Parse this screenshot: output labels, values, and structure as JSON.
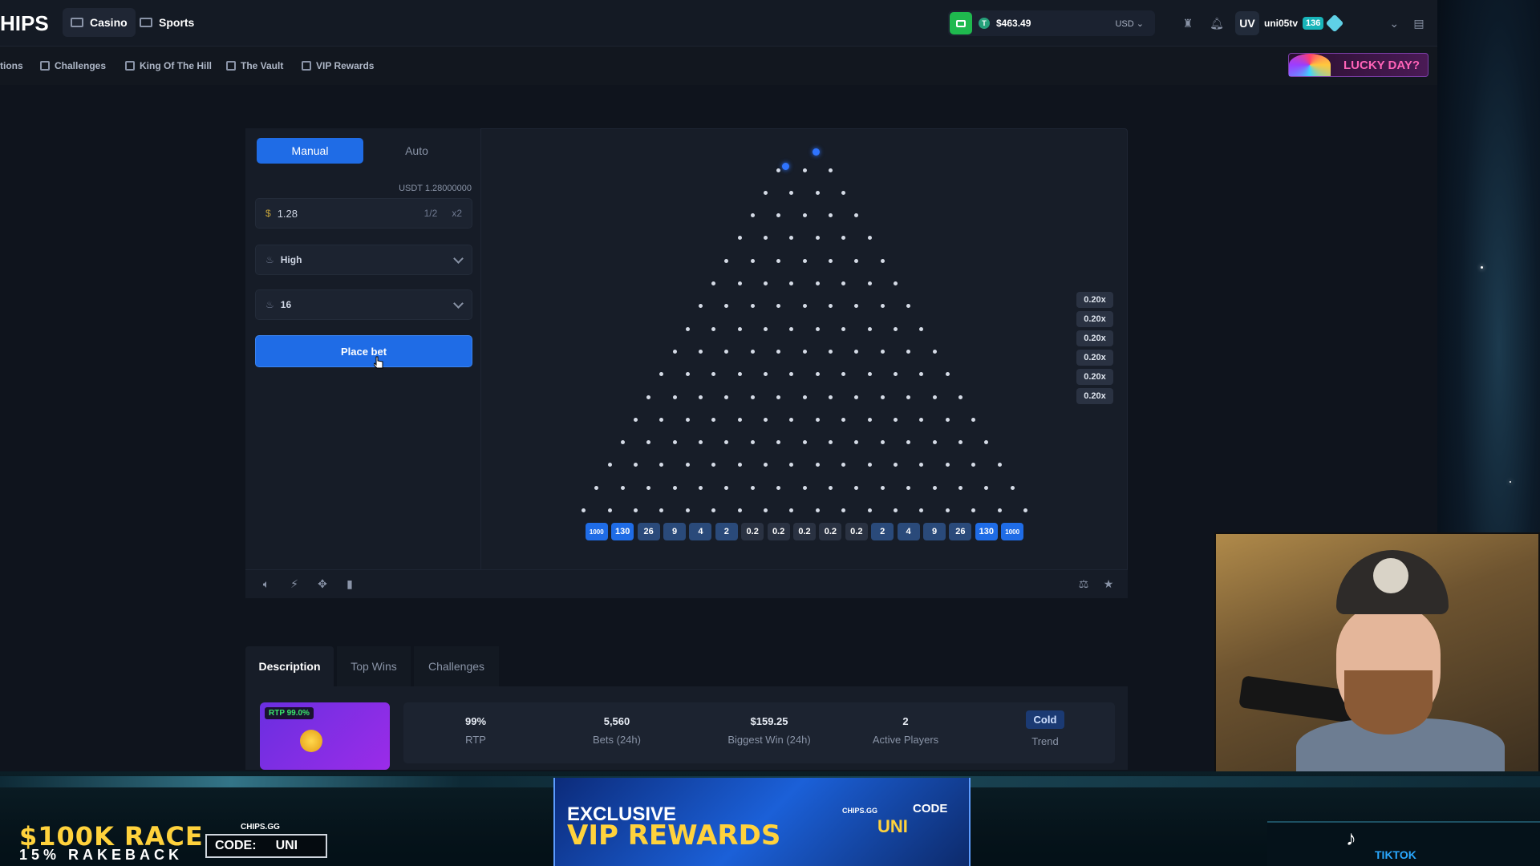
{
  "topbar": {
    "logo": "HIPS",
    "nav": [
      {
        "label": "Casino"
      },
      {
        "label": "Sports"
      }
    ],
    "wallet": {
      "coin_letter": "T",
      "balance": "$463.49",
      "currency": "USD"
    },
    "user": {
      "avatar": "UV",
      "name": "uni05tv",
      "level": "136"
    }
  },
  "subnav": {
    "items": [
      {
        "label": "tions"
      },
      {
        "label": "Challenges"
      },
      {
        "label": "King Of The Hill"
      },
      {
        "label": "The Vault"
      },
      {
        "label": "VIP Rewards"
      }
    ],
    "promo": "LUCKY DAY?"
  },
  "bet_panel": {
    "modes": [
      "Manual",
      "Auto"
    ],
    "balance_label": "USDT 1.28000000",
    "bet_currency": "$",
    "bet_amount": "1.28",
    "half_label": "1/2",
    "double_label": "x2",
    "risk": "High",
    "rows": "16",
    "place_bet": "Place bet"
  },
  "board": {
    "rows": 16,
    "multipliers": [
      "1000",
      "130",
      "26",
      "9",
      "4",
      "2",
      "0.2",
      "0.2",
      "0.2",
      "0.2",
      "0.2",
      "2",
      "4",
      "9",
      "26",
      "130",
      "1000"
    ],
    "recent_results": [
      "0.20x",
      "0.20x",
      "0.20x",
      "0.20x",
      "0.20x",
      "0.20x"
    ],
    "colors": {
      "edge": "#1f6ce6",
      "mid": "#2a4a7a",
      "center": "#2a3242"
    }
  },
  "tabs": [
    "Description",
    "Top Wins",
    "Challenges"
  ],
  "thumbnail": {
    "rtp_badge": "RTP 99.0%"
  },
  "stats": [
    {
      "value": "99%",
      "label": "RTP"
    },
    {
      "value": "5,560",
      "label": "Bets (24h)"
    },
    {
      "value": "$159.25",
      "label": "Biggest Win (24h)"
    },
    {
      "value": "2",
      "label": "Active Players"
    },
    {
      "value": "Cold",
      "label": "Trend"
    }
  ],
  "overlay": {
    "race": "$100K RACE",
    "rakeback": "15% RAKEBACK",
    "chips_small": "CHIPS.GG",
    "code_label": "CODE:",
    "code_value": "UNI",
    "vip_line1": "EXCLUSIVE",
    "vip_line2": "VIP REWARDS",
    "vip_chips": "CHIPS.GG",
    "vip_code": "CODE",
    "vip_uni": "UNI",
    "tiktok": "TIKTOK"
  }
}
